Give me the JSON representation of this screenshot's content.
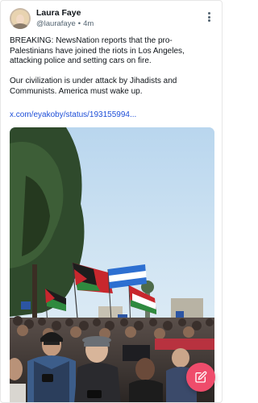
{
  "post": {
    "author": {
      "name": "Laura Faye",
      "handle": "@laurafaye",
      "separator": "•",
      "time": "4m"
    },
    "paragraphs": [
      "BREAKING: NewsNation reports that the pro-Palestinians have joined the riots in Los Angeles, attacking police and setting cars on fire.",
      "Our civilization is under attack by Jihadists and Communists. America must wake up."
    ],
    "link_text": "x.com/eyakoby/status/193155994...",
    "media": {
      "icon": "photo"
    }
  },
  "actions": {
    "more_icon": "more-vertical-icon",
    "compose_icon": "compose-pencil-icon"
  },
  "colors": {
    "link": "#1d4ed8",
    "fab": "#ef4c6b",
    "secondary_text": "#536471"
  }
}
